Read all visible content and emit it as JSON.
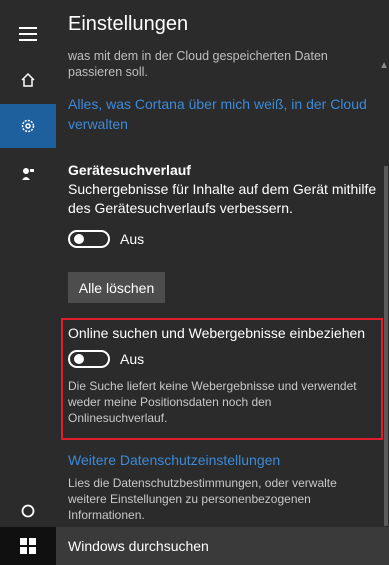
{
  "header": {
    "title": "Einstellungen"
  },
  "rail": {
    "items": [
      {
        "icon": "hamburger-icon"
      },
      {
        "icon": "home-icon"
      },
      {
        "icon": "gear-icon"
      },
      {
        "icon": "feedback-icon"
      },
      {
        "icon": "cortana-circle-icon"
      }
    ]
  },
  "content": {
    "faded_text": "was mit dem in der Cloud gespeicherten Daten passieren soll.",
    "cortana_link": "Alles, was Cortana über mich weiß, in der Cloud verwalten",
    "device_history": {
      "title": "Gerätesuchverlauf",
      "description": "Suchergebnisse für Inhalte auf dem Gerät mithilfe des Gerätesuchverlaufs verbessern.",
      "toggle_label": "Aus",
      "clear_button": "Alle löschen"
    },
    "online_search": {
      "title": "Online suchen und Webergebnisse einbeziehen",
      "toggle_label": "Aus",
      "description": "Die Suche liefert keine Webergebnisse und verwendet weder meine Positionsdaten noch den Onlinesuchverlauf."
    },
    "more_privacy": {
      "link": "Weitere Datenschutzeinstellungen",
      "description": "Lies die Datenschutzbestimmungen, oder verwalte weitere Einstellungen zu personenbezogenen Informationen."
    }
  },
  "taskbar": {
    "search_placeholder": "Windows durchsuchen"
  },
  "colors": {
    "accent": "#1e5f9e",
    "link": "#3c8ad8",
    "highlight_border": "#e01e2e"
  }
}
